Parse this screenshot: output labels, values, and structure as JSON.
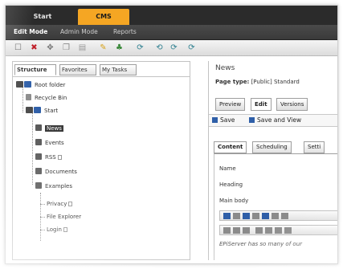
{
  "top_tabs": [
    {
      "label": "Start"
    },
    {
      "label": "CMS"
    }
  ],
  "modes": [
    {
      "label": "Edit Mode"
    },
    {
      "label": "Admin Mode"
    },
    {
      "label": "Reports"
    }
  ],
  "toolbar_icons": [
    "new-page-icon",
    "delete-icon",
    "move-icon",
    "copy-icon",
    "paste-icon",
    "edit-icon",
    "bookmark-icon",
    "refresh-icon",
    "back-icon",
    "forward-icon",
    "sync-icon"
  ],
  "left_tabs": [
    {
      "label": "Structure"
    },
    {
      "label": "Favorites"
    },
    {
      "label": "My Tasks"
    }
  ],
  "tree": {
    "root": "Root folder",
    "recycle_bin": "Recycle Bin",
    "start": "Start",
    "news": "News",
    "events": "Events",
    "rss": "RSS",
    "documents": "Documents",
    "examples": "Examples",
    "privacy": "Privacy",
    "file_explorer": "File Explorer",
    "login": "Login"
  },
  "page": {
    "title": "News",
    "type_label": "Page type:",
    "type_value": "[Public] Standard"
  },
  "right_tabs": [
    {
      "label": "Preview"
    },
    {
      "label": "Edit"
    },
    {
      "label": "Versions"
    }
  ],
  "save": {
    "save_label": "Save",
    "save_view_label": "Save and View"
  },
  "sub_tabs": [
    {
      "label": "Content"
    },
    {
      "label": "Scheduling"
    },
    {
      "label": "Setti"
    }
  ],
  "fields": {
    "name": "Name",
    "heading": "Heading",
    "main_body": "Main body",
    "body_text": "EPiServer has so many of our"
  },
  "colors": {
    "accent": "#f5a623",
    "topbar": "#2b2b2b",
    "link_blue": "#2f5fa8"
  }
}
